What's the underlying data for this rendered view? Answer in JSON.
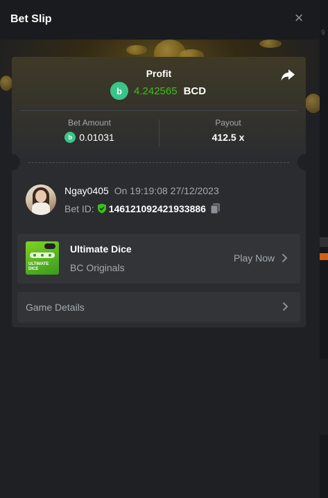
{
  "header": {
    "title": "Bet Slip",
    "close_symbol": "×"
  },
  "profit": {
    "label": "Profit",
    "coin_letter": "b",
    "value": "4.242565",
    "currency": "BCD"
  },
  "bet_amount": {
    "label": "Bet Amount",
    "value": "0.01031"
  },
  "payout": {
    "label": "Payout",
    "value": "412.5 x"
  },
  "user": {
    "name": "Ngay0405",
    "timestamp": "On 19:19:08 27/12/2023",
    "bet_id_label": "Bet ID:",
    "bet_id": "146121092421933886"
  },
  "game": {
    "title": "Ultimate Dice",
    "provider": "BC Originals",
    "play_label": "Play Now",
    "thumb_caption": "ULTIMATE DICE"
  },
  "details": {
    "label": "Game Details"
  },
  "colors": {
    "profit_green": "#3bc117",
    "bcd_coin": "#3bc48a",
    "shield_green": "#3bc117",
    "strip_orange": "#d35f14"
  },
  "icons": {
    "close": "close-icon",
    "share": "share-icon",
    "verified": "shield-check-icon",
    "copy": "copy-icon",
    "chevron": "chevron-right-icon"
  },
  "right_strip_glyph": "9"
}
